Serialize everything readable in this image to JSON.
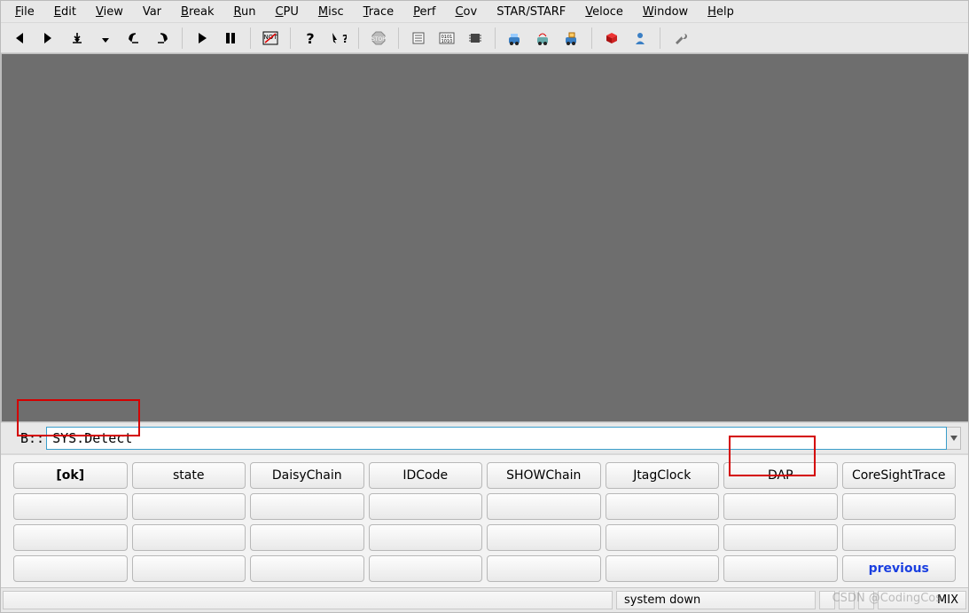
{
  "menu": {
    "items": [
      {
        "label": "File",
        "mn": "F"
      },
      {
        "label": "Edit",
        "mn": "E"
      },
      {
        "label": "View",
        "mn": "V"
      },
      {
        "label": "Var",
        "mn": ""
      },
      {
        "label": "Break",
        "mn": "B"
      },
      {
        "label": "Run",
        "mn": "R"
      },
      {
        "label": "CPU",
        "mn": "C"
      },
      {
        "label": "Misc",
        "mn": "M"
      },
      {
        "label": "Trace",
        "mn": "T"
      },
      {
        "label": "Perf",
        "mn": "P"
      },
      {
        "label": "Cov",
        "mn": "C"
      },
      {
        "label": "STAR/STARF",
        "mn": ""
      },
      {
        "label": "Veloce",
        "mn": "V"
      },
      {
        "label": "Window",
        "mn": "W"
      },
      {
        "label": "Help",
        "mn": "H"
      }
    ]
  },
  "toolbar": {
    "icons": [
      "step-icon",
      "step-over-icon",
      "step-into-icon",
      "step-down-icon",
      "step-back-icon",
      "step-forward-icon",
      "sep",
      "run-icon",
      "pause-icon",
      "sep",
      "not-icon",
      "sep",
      "help-icon",
      "context-help-icon",
      "sep",
      "stop-icon",
      "sep",
      "list-icon",
      "binary-icon",
      "chip-icon",
      "sep",
      "trace-icon",
      "trace2-icon",
      "trace3-icon",
      "sep",
      "cube-icon",
      "user-icon",
      "sep",
      "wrench-icon"
    ]
  },
  "command": {
    "prompt": "B::",
    "value": "SYS.Detect"
  },
  "buttons": {
    "rows": [
      [
        "[ok]",
        "state",
        "DaisyChain",
        "IDCode",
        "SHOWChain",
        "JtagClock",
        "DAP",
        "CoreSightTrace"
      ],
      [
        "",
        "",
        "",
        "",
        "",
        "",
        "",
        ""
      ],
      [
        "",
        "",
        "",
        "",
        "",
        "",
        "",
        ""
      ],
      [
        "",
        "",
        "",
        "",
        "",
        "",
        "",
        "previous"
      ]
    ],
    "bold": [
      "[ok]"
    ],
    "blue": [
      "previous"
    ]
  },
  "status": {
    "main": "",
    "center": "system down",
    "right": "MIX"
  },
  "watermark": "CSDN @CodingCos",
  "colors": {
    "highlight": "#d40000",
    "link": "#1a3fe0",
    "workspace": "#6e6e6e"
  }
}
